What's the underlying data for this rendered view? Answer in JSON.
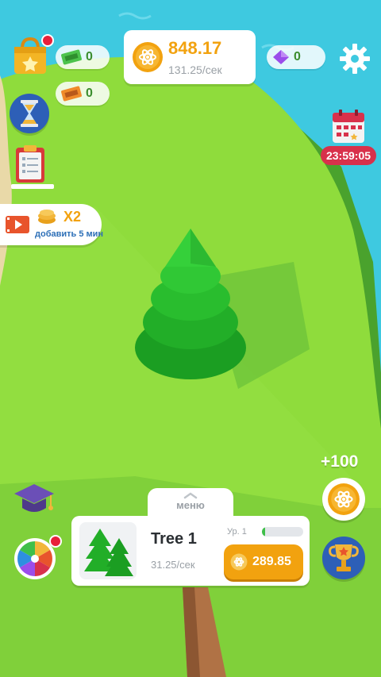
{
  "currency": {
    "coins_value": "848.17",
    "coins_rate": "131.25/сек",
    "tickets_green": "0",
    "tickets_orange": "0",
    "gems": "0"
  },
  "event": {
    "timer": "23:59:05"
  },
  "boost": {
    "multiplier": "X2",
    "label": "добавить 5 мин"
  },
  "reward": {
    "plus_label": "+100"
  },
  "menu": {
    "tab_label": "меню",
    "card": {
      "title": "Tree 1",
      "rate": "31.25/сек",
      "level_label": "Ур. 1",
      "level_progress": 0.08,
      "upgrade_price": "289.85"
    }
  },
  "colors": {
    "accent_green": "#3b8d2e",
    "coin_orange": "#f2a20f",
    "sky": "#3ec9e0",
    "grass": "#8fdc3c",
    "timer_red": "#d8314b"
  },
  "icons": [
    "shop-bag-icon",
    "ticket-green-icon",
    "ticket-orange-icon",
    "hourglass-icon",
    "clipboard-icon",
    "video-icon",
    "coin-atom-icon",
    "gem-icon",
    "gear-icon",
    "calendar-icon",
    "graduation-cap-icon",
    "spin-wheel-icon",
    "trophy-icon",
    "chevron-up-icon"
  ]
}
